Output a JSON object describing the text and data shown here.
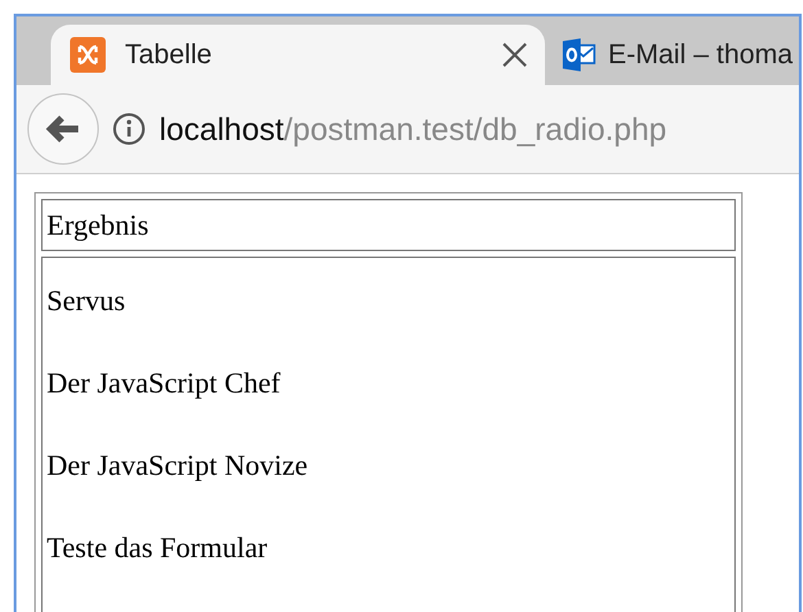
{
  "tabs": [
    {
      "title": "Tabelle",
      "selected": true,
      "kind": "xampp"
    },
    {
      "title": "E-Mail – thoma",
      "selected": false,
      "kind": "outlook"
    }
  ],
  "address": {
    "host": "localhost",
    "path": "/postman.test/db_radio.php"
  },
  "table": {
    "header": "Ergebnis",
    "lines": [
      "Servus",
      "Der JavaScript Chef",
      "Der JavaScript Novize",
      "Teste das Formular"
    ]
  }
}
